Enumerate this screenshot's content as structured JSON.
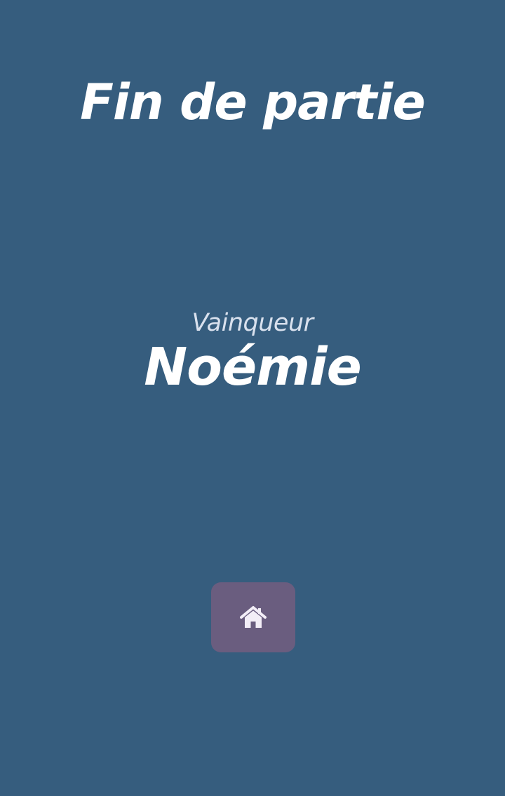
{
  "header": {
    "title": "Fin de partie"
  },
  "result": {
    "winner_label": "Vainqueur",
    "winner_name": "Noémie"
  },
  "actions": {
    "home_button": {
      "icon": "home-icon"
    }
  },
  "colors": {
    "background": "#365d7e",
    "button": "#6a5d7f",
    "text": "#ffffff",
    "label_text": "#d9e1ee"
  }
}
